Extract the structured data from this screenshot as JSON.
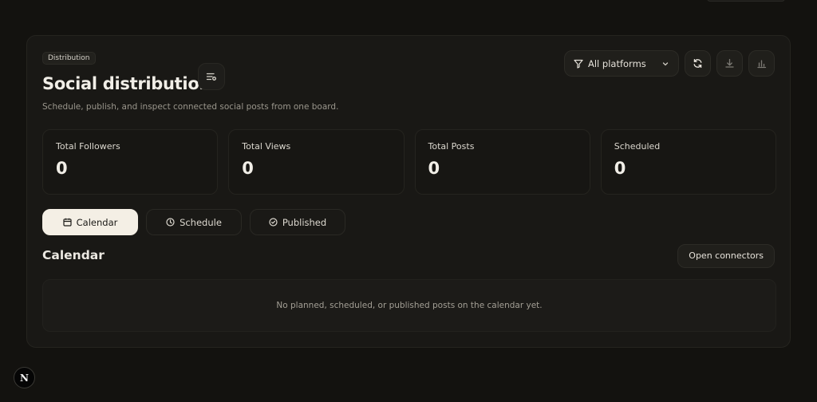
{
  "header": {
    "chip": "Distribution",
    "title": "Social distribution",
    "subtitle": "Schedule, publish, and inspect connected social posts from one board."
  },
  "toolbar": {
    "filter_label": "All platforms",
    "filter_icon": "filter-icon",
    "refresh_icon": "refresh-icon",
    "download_icon": "download-icon",
    "analytics_icon": "bar-chart-icon"
  },
  "stats": [
    {
      "label": "Total Followers",
      "value": "0"
    },
    {
      "label": "Total Views",
      "value": "0"
    },
    {
      "label": "Total Posts",
      "value": "0"
    },
    {
      "label": "Scheduled",
      "value": "0"
    }
  ],
  "tabs": [
    {
      "label": "Calendar",
      "icon": "calendar-icon",
      "active": true
    },
    {
      "label": "Schedule",
      "icon": "clock-icon",
      "active": false
    },
    {
      "label": "Published",
      "icon": "check-circle-icon",
      "active": false
    }
  ],
  "section": {
    "title": "Calendar",
    "action_label": "Open connectors",
    "empty_message": "No planned, scheduled, or published posts on the calendar yet."
  },
  "footer": {
    "badge": "N"
  },
  "colors": {
    "background": "#13120f",
    "panel": "#191815",
    "active_tab": "#f4efe5",
    "text": "#e9e6df",
    "muted": "#9a968c"
  }
}
